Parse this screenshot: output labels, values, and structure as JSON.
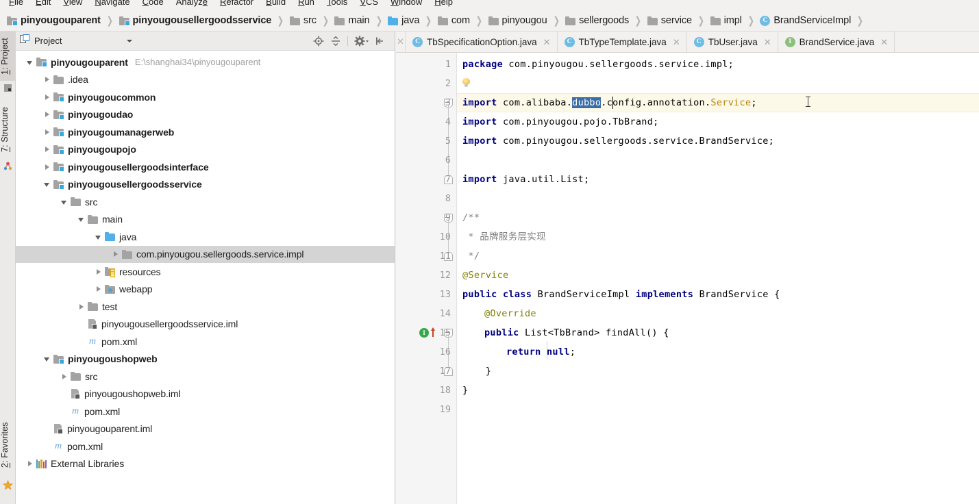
{
  "menu": {
    "items": [
      "File",
      "Edit",
      "View",
      "Navigate",
      "Code",
      "Analyze",
      "Refactor",
      "Build",
      "Run",
      "Tools",
      "VCS",
      "Window",
      "Help"
    ]
  },
  "breadcrumb": {
    "items": [
      {
        "label": "pinyougouparent",
        "icon": "module-folder-icon",
        "bold": true
      },
      {
        "label": "pinyougousellergoodsservice",
        "icon": "module-folder-icon",
        "bold": true
      },
      {
        "label": "src",
        "icon": "folder-icon",
        "bold": false
      },
      {
        "label": "main",
        "icon": "folder-icon",
        "bold": false
      },
      {
        "label": "java",
        "icon": "source-folder-icon",
        "bold": false
      },
      {
        "label": "com",
        "icon": "folder-icon",
        "bold": false
      },
      {
        "label": "pinyougou",
        "icon": "folder-icon",
        "bold": false
      },
      {
        "label": "sellergoods",
        "icon": "folder-icon",
        "bold": false
      },
      {
        "label": "service",
        "icon": "folder-icon",
        "bold": false
      },
      {
        "label": "impl",
        "icon": "folder-icon",
        "bold": false
      },
      {
        "label": "BrandServiceImpl",
        "icon": "class-icon",
        "bold": false
      }
    ],
    "separator": "❯"
  },
  "toolstrip": {
    "left_top": [
      {
        "num": "1",
        "label": ": Project",
        "icon": "project-icon",
        "active": true
      },
      {
        "num": "7",
        "label": ": Structure",
        "icon": "structure-icon",
        "active": false
      }
    ],
    "left_bottom": [
      {
        "num": "2",
        "label": ": Favorites",
        "icon": "star-icon",
        "active": false
      }
    ]
  },
  "project_panel": {
    "title": "Project",
    "tools": [
      {
        "name": "locate-icon",
        "title": "Select Opened File"
      },
      {
        "name": "collapse-all-icon",
        "title": "Collapse All"
      },
      {
        "name": "gear-icon",
        "title": "Settings"
      },
      {
        "name": "hide-icon",
        "title": "Hide"
      }
    ],
    "tree": [
      {
        "indent": 0,
        "arrow": "expanded",
        "icon": "module-folder-icon",
        "label": "pinyougouparent",
        "bold": true,
        "path": "E:\\shanghai34\\pinyougouparent",
        "selected": false
      },
      {
        "indent": 1,
        "arrow": "collapsed",
        "icon": "folder-icon",
        "label": ".idea",
        "bold": false,
        "path": "",
        "selected": false
      },
      {
        "indent": 1,
        "arrow": "collapsed",
        "icon": "module-folder-icon",
        "label": "pinyougoucommon",
        "bold": true,
        "path": "",
        "selected": false
      },
      {
        "indent": 1,
        "arrow": "collapsed",
        "icon": "module-folder-icon",
        "label": "pinyougoudao",
        "bold": true,
        "path": "",
        "selected": false
      },
      {
        "indent": 1,
        "arrow": "collapsed",
        "icon": "module-folder-icon",
        "label": "pinyougoumanagerweb",
        "bold": true,
        "path": "",
        "selected": false
      },
      {
        "indent": 1,
        "arrow": "collapsed",
        "icon": "module-folder-icon",
        "label": "pinyougoupojo",
        "bold": true,
        "path": "",
        "selected": false
      },
      {
        "indent": 1,
        "arrow": "collapsed",
        "icon": "module-folder-icon",
        "label": "pinyougousellergoodsinterface",
        "bold": true,
        "path": "",
        "selected": false
      },
      {
        "indent": 1,
        "arrow": "expanded",
        "icon": "module-folder-icon",
        "label": "pinyougousellergoodsservice",
        "bold": true,
        "path": "",
        "selected": false
      },
      {
        "indent": 2,
        "arrow": "expanded",
        "icon": "folder-icon",
        "label": "src",
        "bold": false,
        "path": "",
        "selected": false
      },
      {
        "indent": 3,
        "arrow": "expanded",
        "icon": "folder-icon",
        "label": "main",
        "bold": false,
        "path": "",
        "selected": false
      },
      {
        "indent": 4,
        "arrow": "expanded",
        "icon": "source-folder-icon",
        "label": "java",
        "bold": false,
        "path": "",
        "selected": false
      },
      {
        "indent": 5,
        "arrow": "collapsed",
        "icon": "package-icon",
        "label": "com.pinyougou.sellergoods.service.impl",
        "bold": false,
        "path": "",
        "selected": true
      },
      {
        "indent": 4,
        "arrow": "collapsed",
        "icon": "resources-folder-icon",
        "label": "resources",
        "bold": false,
        "path": "",
        "selected": false
      },
      {
        "indent": 4,
        "arrow": "collapsed",
        "icon": "webapp-folder-icon",
        "label": "webapp",
        "bold": false,
        "path": "",
        "selected": false
      },
      {
        "indent": 3,
        "arrow": "collapsed",
        "icon": "folder-icon",
        "label": "test",
        "bold": false,
        "path": "",
        "selected": false
      },
      {
        "indent": 3,
        "arrow": "none",
        "icon": "iml-file-icon",
        "label": "pinyougousellergoodsservice.iml",
        "bold": false,
        "path": "",
        "selected": false
      },
      {
        "indent": 3,
        "arrow": "none",
        "icon": "maven-file-icon",
        "label": "pom.xml",
        "bold": false,
        "path": "",
        "selected": false
      },
      {
        "indent": 1,
        "arrow": "expanded",
        "icon": "module-folder-icon",
        "label": "pinyougoushopweb",
        "bold": true,
        "path": "",
        "selected": false
      },
      {
        "indent": 2,
        "arrow": "collapsed",
        "icon": "folder-icon",
        "label": "src",
        "bold": false,
        "path": "",
        "selected": false
      },
      {
        "indent": 2,
        "arrow": "none",
        "icon": "iml-file-icon",
        "label": "pinyougoushopweb.iml",
        "bold": false,
        "path": "",
        "selected": false
      },
      {
        "indent": 2,
        "arrow": "none",
        "icon": "maven-file-icon",
        "label": "pom.xml",
        "bold": false,
        "path": "",
        "selected": false
      },
      {
        "indent": 1,
        "arrow": "none",
        "icon": "iml-file-icon",
        "label": "pinyougouparent.iml",
        "bold": false,
        "path": "",
        "selected": false
      },
      {
        "indent": 1,
        "arrow": "none",
        "icon": "maven-file-icon",
        "label": "pom.xml",
        "bold": false,
        "path": "",
        "selected": false
      },
      {
        "indent": 0,
        "arrow": "collapsed",
        "icon": "libraries-icon",
        "label": "External Libraries",
        "bold": false,
        "path": "",
        "selected": false
      }
    ]
  },
  "editor": {
    "tabs": [
      {
        "label": "TbSpecificationOption.java",
        "icon": "class-icon",
        "kind": "class",
        "active": false,
        "close": "✕"
      },
      {
        "label": "TbTypeTemplate.java",
        "icon": "class-icon",
        "kind": "class",
        "active": false,
        "close": "✕"
      },
      {
        "label": "TbUser.java",
        "icon": "class-icon",
        "kind": "class",
        "active": false,
        "close": "✕"
      },
      {
        "label": "BrandService.java",
        "icon": "interface-icon",
        "kind": "interface",
        "active": false,
        "close": "✕"
      }
    ],
    "current_line": 3,
    "caret_line": 3,
    "lines": [
      {
        "n": 1,
        "text": "package com.pinyougou.sellergoods.service.impl;"
      },
      {
        "n": 2,
        "text": ""
      },
      {
        "n": 3,
        "text": "import com.alibaba.dubbo.config.annotation.Service;"
      },
      {
        "n": 4,
        "text": "import com.pinyougou.pojo.TbBrand;"
      },
      {
        "n": 5,
        "text": "import com.pinyougou.sellergoods.service.BrandService;"
      },
      {
        "n": 6,
        "text": ""
      },
      {
        "n": 7,
        "text": "import java.util.List;"
      },
      {
        "n": 8,
        "text": ""
      },
      {
        "n": 9,
        "text": "/**"
      },
      {
        "n": 10,
        "text": " * 品牌服务层实现"
      },
      {
        "n": 11,
        "text": " */"
      },
      {
        "n": 12,
        "text": "@Service"
      },
      {
        "n": 13,
        "text": "public class BrandServiceImpl implements BrandService {"
      },
      {
        "n": 14,
        "text": "    @Override"
      },
      {
        "n": 15,
        "text": "    public List<TbBrand> findAll() {"
      },
      {
        "n": 16,
        "text": "        return null;"
      },
      {
        "n": 17,
        "text": "    }"
      },
      {
        "n": 18,
        "text": "}"
      },
      {
        "n": 19,
        "text": ""
      }
    ],
    "selection": {
      "text": "dubbo",
      "line": 3
    },
    "gutter_icons": [
      {
        "line": 2,
        "name": "intention-bulb-icon"
      },
      {
        "line": 15,
        "name": "implementing-method-icon",
        "glyph": "I"
      }
    ],
    "comment_cjk": "品牌服务层实现"
  },
  "colors": {
    "keyword": "#000080",
    "comment": "#808080",
    "annotation": "#808000",
    "selection": "#3a6ea5",
    "current_line": "#fcf9e8",
    "class_icon": "#6ebce4",
    "interface_icon": "#8dc07d",
    "module_badge": "#35a8e0",
    "source_root": "#51b0e7"
  }
}
